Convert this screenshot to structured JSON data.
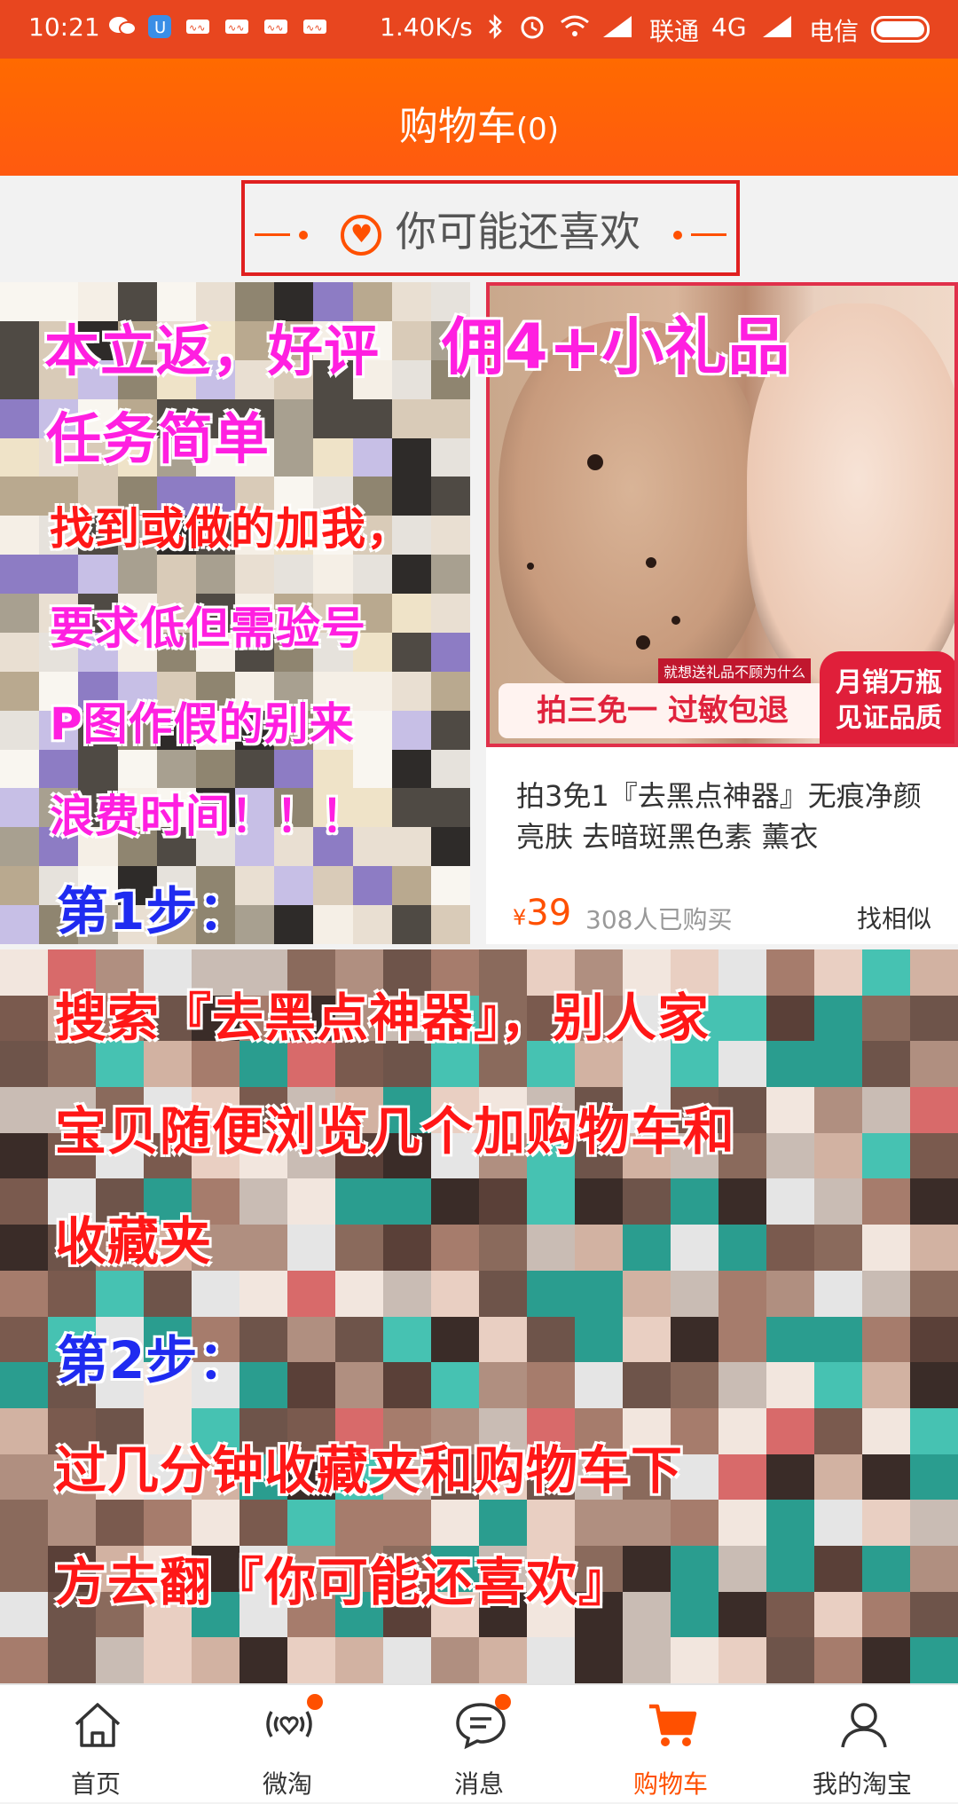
{
  "status_bar": {
    "time": "10:21",
    "speed": "1.40K/s",
    "carrier1": "联通",
    "network": "4G",
    "carrier2": "电信"
  },
  "header": {
    "title": "购物车",
    "count": "(0)"
  },
  "may_like": {
    "label": "你可能还喜欢"
  },
  "product": {
    "promo_text": "拍三免一 过敏包退",
    "badge_text": "月销万瓶 见证品质",
    "badge_note": "就想送礼品不顾为什么",
    "title": "拍3免1『去黑点神器』无痕净颜亮肤 去暗斑黑色素 薰衣",
    "currency": "¥",
    "price": "39",
    "sold": "308人已购买",
    "similar": "找相似"
  },
  "overlay": {
    "line1a": "本立返，好评",
    "line1b": "佣4+小礼品",
    "line2": "任务简单",
    "line3": "找到或做的加我，",
    "line4": "要求低但需验号",
    "line5": "P图作假的别来",
    "line6": "浪费时间！！！",
    "step1": "第1步：",
    "step1_text1": "搜索『去黑点神器』，别人家",
    "step1_text2": "宝贝随便浏览几个加购物车和",
    "step1_text3": "收藏夹",
    "step2": "第2步：",
    "step2_text1": "过几分钟收藏夹和购物车下",
    "step2_text2": "方去翻『你可能还喜欢』"
  },
  "tabs": [
    {
      "label": "首页",
      "icon": "home-icon"
    },
    {
      "label": "微淘",
      "icon": "weitao-icon"
    },
    {
      "label": "消息",
      "icon": "message-icon"
    },
    {
      "label": "购物车",
      "icon": "cart-icon"
    },
    {
      "label": "我的淘宝",
      "icon": "profile-icon"
    }
  ],
  "colors": {
    "accent": "#ff5000",
    "status_bar": "#e8461f"
  }
}
